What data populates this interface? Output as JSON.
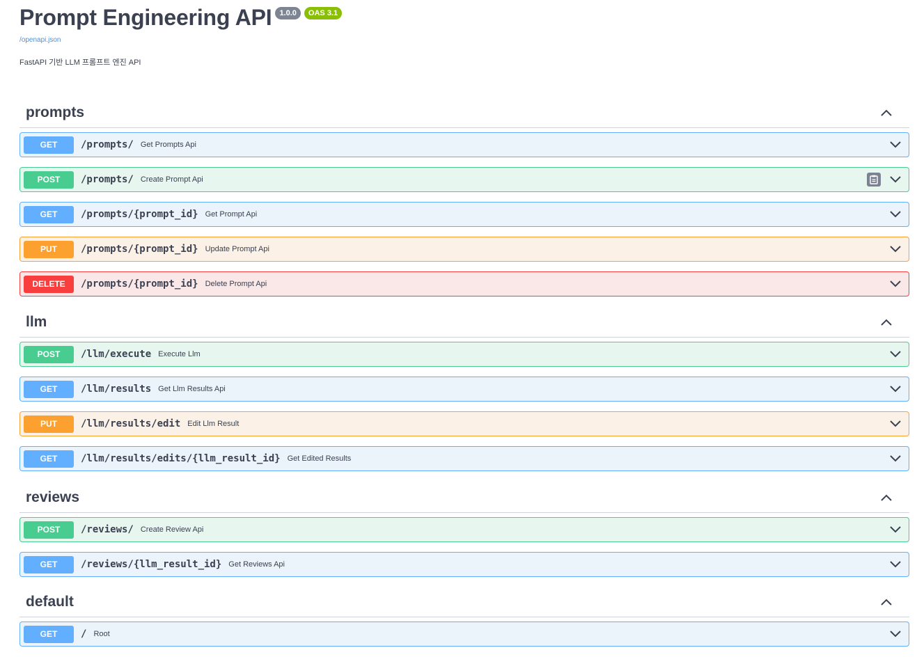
{
  "info": {
    "title": "Prompt Engineering API",
    "version": "1.0.0",
    "oas": "OAS 3.1",
    "spec_link": "/openapi.json",
    "description": "FastAPI 기반 LLM 프롬프트 엔진 API"
  },
  "colors": {
    "get": "#61affe",
    "post": "#49cc90",
    "put": "#fca130",
    "delete": "#f93e3e"
  },
  "sections": [
    {
      "name": "prompts",
      "operations": [
        {
          "method": "GET",
          "path": "/prompts/",
          "summary": "Get Prompts Api"
        },
        {
          "method": "POST",
          "path": "/prompts/",
          "summary": "Create Prompt Api",
          "copy_icon": "clipboard-icon"
        },
        {
          "method": "GET",
          "path": "/prompts/{prompt_id}",
          "summary": "Get Prompt Api"
        },
        {
          "method": "PUT",
          "path": "/prompts/{prompt_id}",
          "summary": "Update Prompt Api"
        },
        {
          "method": "DELETE",
          "path": "/prompts/{prompt_id}",
          "summary": "Delete Prompt Api"
        }
      ]
    },
    {
      "name": "llm",
      "operations": [
        {
          "method": "POST",
          "path": "/llm/execute",
          "summary": "Execute Llm"
        },
        {
          "method": "GET",
          "path": "/llm/results",
          "summary": "Get Llm Results Api"
        },
        {
          "method": "PUT",
          "path": "/llm/results/edit",
          "summary": "Edit Llm Result"
        },
        {
          "method": "GET",
          "path": "/llm/results/edits/{llm_result_id}",
          "summary": "Get Edited Results"
        }
      ]
    },
    {
      "name": "reviews",
      "operations": [
        {
          "method": "POST",
          "path": "/reviews/",
          "summary": "Create Review Api"
        },
        {
          "method": "GET",
          "path": "/reviews/{llm_result_id}",
          "summary": "Get Reviews Api"
        }
      ]
    },
    {
      "name": "default",
      "operations": [
        {
          "method": "GET",
          "path": "/",
          "summary": "Root"
        }
      ]
    }
  ]
}
